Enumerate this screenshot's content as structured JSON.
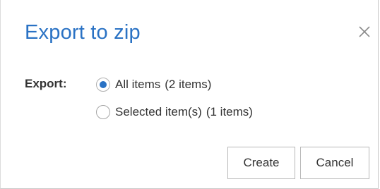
{
  "dialog": {
    "title": "Export to zip",
    "close_icon": "close-icon"
  },
  "export": {
    "label": "Export:",
    "options": [
      {
        "label": "All items",
        "count": "(2 items)",
        "selected": true
      },
      {
        "label": "Selected item(s)",
        "count": "(1 items)",
        "selected": false
      }
    ]
  },
  "buttons": {
    "create_label": "Create",
    "cancel_label": "Cancel"
  },
  "colors": {
    "accent": "#2a72c4",
    "text": "#333333",
    "border": "#b8b8b8"
  }
}
